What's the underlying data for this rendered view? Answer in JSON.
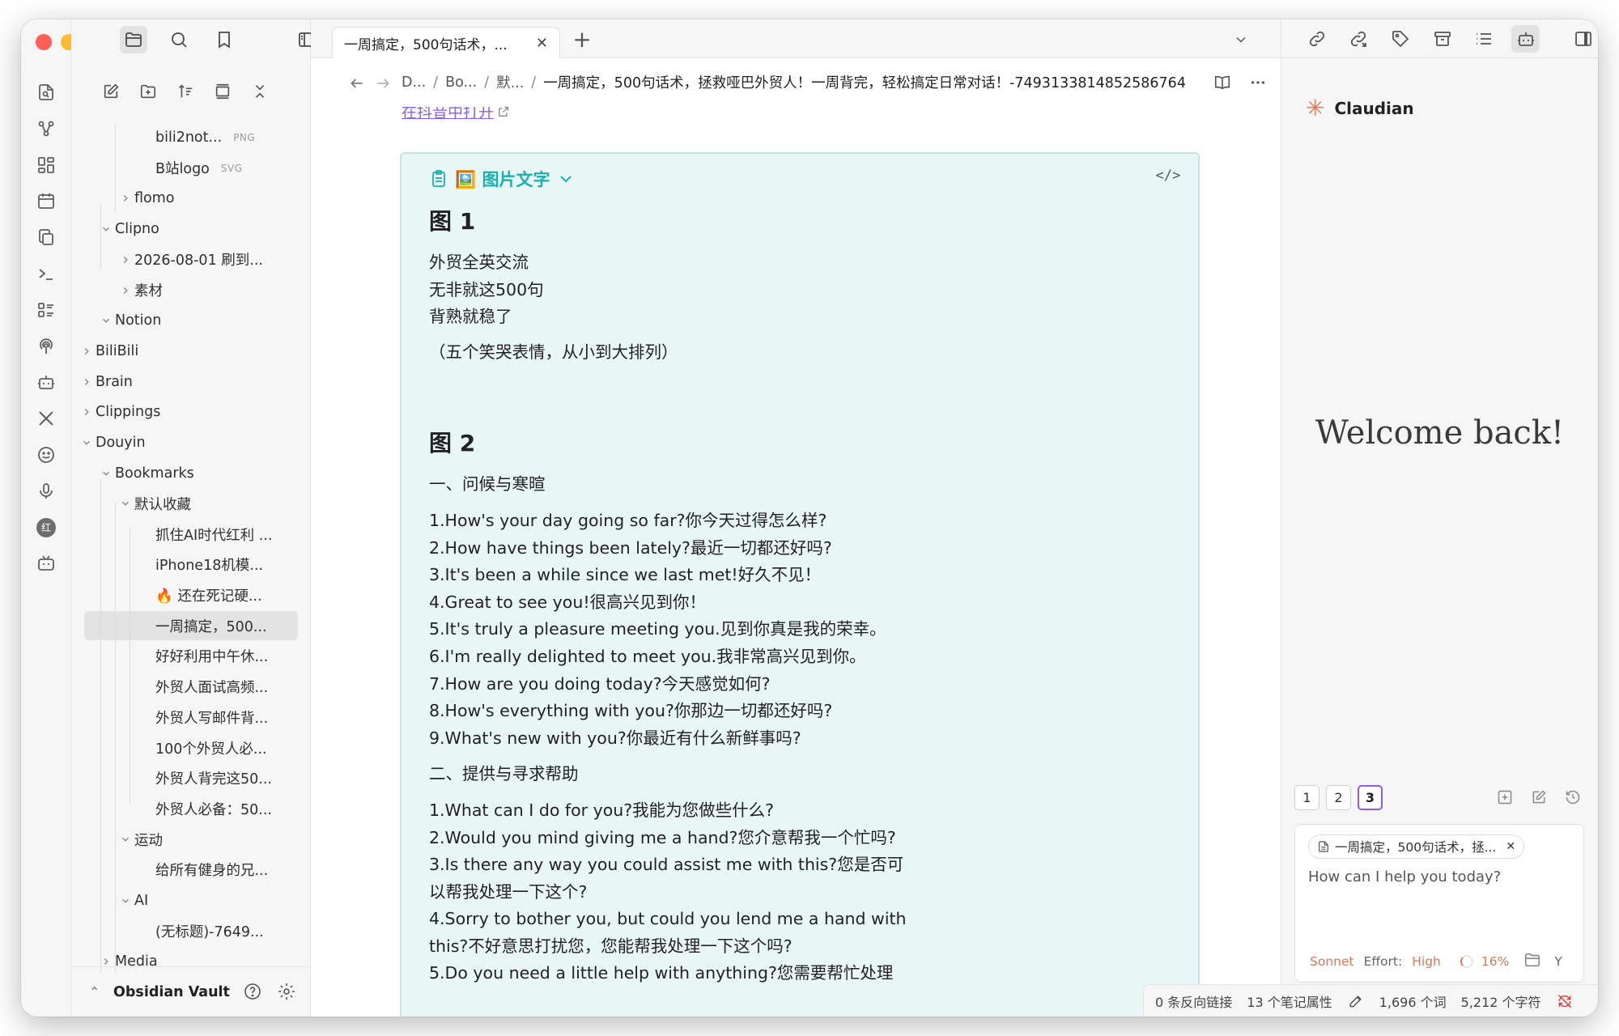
{
  "window": {
    "traffic_colors": [
      "#fe5f57",
      "#febc2e",
      "#28c840"
    ]
  },
  "ribbon": {
    "icons": [
      "file-search-icon",
      "graph-icon",
      "canvas-icon",
      "calendar-icon",
      "copy-icon",
      "terminal-icon",
      "list-icon",
      "podcast-icon",
      "bot-icon",
      "x-logo-icon",
      "face-icon",
      "microphone-icon",
      "xiaohongshu-icon",
      "bilibili-icon"
    ],
    "xiaohongshu_label": "红"
  },
  "sidebar": {
    "top_icons": [
      "folder-icon",
      "search-icon",
      "bookmark-icon"
    ],
    "toggle_icon": "sidebar-toggle-icon",
    "actions": [
      "new-note-icon",
      "new-folder-icon",
      "sort-icon",
      "collapse-icon",
      "close-all-icon"
    ],
    "tree": [
      {
        "label": "bili2not...",
        "ext": "PNG",
        "level": 4,
        "type": "file"
      },
      {
        "label": "B站logo",
        "ext": "SVG",
        "level": 4,
        "type": "file"
      },
      {
        "label": "flomo",
        "level": 3,
        "type": "folder",
        "open": false
      },
      {
        "label": "Clipno",
        "level": 2,
        "type": "folder",
        "open": true
      },
      {
        "label": "2026-08-01 刷到...",
        "level": 3,
        "type": "folder",
        "open": false
      },
      {
        "label": "素材",
        "level": 3,
        "type": "folder",
        "open": false
      },
      {
        "label": "Notion",
        "level": 2,
        "type": "folder",
        "open": true
      },
      {
        "label": "BiliBili",
        "level": 1,
        "type": "folder",
        "open": false
      },
      {
        "label": "Brain",
        "level": 1,
        "type": "folder",
        "open": false
      },
      {
        "label": "Clippings",
        "level": 1,
        "type": "folder",
        "open": false
      },
      {
        "label": "Douyin",
        "level": 1,
        "type": "folder",
        "open": true
      },
      {
        "label": "Bookmarks",
        "level": 2,
        "type": "folder",
        "open": true
      },
      {
        "label": "默认收藏",
        "level": 3,
        "type": "folder",
        "open": true
      },
      {
        "label": "抓住AI时代红利 ...",
        "level": 4,
        "type": "file"
      },
      {
        "label": "iPhone18机模...",
        "level": 4,
        "type": "file"
      },
      {
        "label": "🔥 还在死记硬...",
        "level": 4,
        "type": "file"
      },
      {
        "label": "一周搞定，500...",
        "level": 4,
        "type": "file",
        "selected": true
      },
      {
        "label": "好好利用中午休...",
        "level": 4,
        "type": "file"
      },
      {
        "label": "外贸人面试高频...",
        "level": 4,
        "type": "file"
      },
      {
        "label": "外贸人写邮件背...",
        "level": 4,
        "type": "file"
      },
      {
        "label": "100个外贸人必...",
        "level": 4,
        "type": "file"
      },
      {
        "label": "外贸人背完这50...",
        "level": 4,
        "type": "file"
      },
      {
        "label": "外贸人必备：50...",
        "level": 4,
        "type": "file"
      },
      {
        "label": "运动",
        "level": 3,
        "type": "folder",
        "open": true
      },
      {
        "label": "给所有健身的兄...",
        "level": 4,
        "type": "file"
      },
      {
        "label": "AI",
        "level": 3,
        "type": "folder",
        "open": true
      },
      {
        "label": "(无标题)-7649...",
        "level": 4,
        "type": "file"
      },
      {
        "label": "Media",
        "level": 2,
        "type": "folder",
        "open": false
      }
    ],
    "vault_name": "Obsidian Vault"
  },
  "editor": {
    "tab_title": "一周搞定，500句话术，...",
    "breadcrumbs": [
      "D...",
      "Bo...",
      "默...",
      "一周搞定，500句话术，拯救哑巴外贸人！一周背完，轻松搞定日常对话！-7493133814852586764"
    ],
    "open_link": "在抖音中打开",
    "callout_title": "🖼️ 图片文字",
    "fig1_heading": "图 1",
    "fig1_lines": [
      "外贸全英交流",
      "无非就这500句",
      "背熟就稳了"
    ],
    "fig1_note": "（五个笑哭表情，从小到大排列）",
    "fig2_heading": "图 2",
    "section1_title": "一、问候与寒暄",
    "section1_lines": [
      "1.How's your day going so far?你今天过得怎么样?",
      "2.How have things been lately?最近一切都还好吗?",
      "3.It's been a while since we last met!好久不见！",
      "4.Great to see you!很高兴见到你！",
      "5.It's truly a pleasure meeting you.见到你真是我的荣幸。",
      "6.I'm really delighted to meet you.我非常高兴见到你。",
      "7.How are you doing today?今天感觉如何?",
      "8.How's everything with you?你那边一切都还好吗?",
      "9.What's new with you?你最近有什么新鲜事吗?"
    ],
    "section2_title": "二、提供与寻求帮助",
    "section2_lines": [
      "1.What can I do for you?我能为您做些什么?",
      "2.Would you mind giving me a hand?您介意帮我一个忙吗?",
      "3.Is there any way you could assist me with this?您是否可",
      "以帮我处理一下这个?",
      "4.Sorry to bother you, but could you lend me a hand with",
      "this?不好意思打扰您，您能帮我处理一下这个吗?",
      "5.Do you need a little help with anything?您需要帮忙处理"
    ]
  },
  "right_panel": {
    "top_icons": [
      "link-icon",
      "outgoing-link-icon",
      "tag-icon",
      "archive-icon",
      "outline-icon",
      "bot-icon",
      "sidebar-right-icon"
    ],
    "app_name": "Claudian",
    "welcome": "Welcome back!",
    "conv_tabs": [
      "1",
      "2",
      "3"
    ],
    "active_conv": "3",
    "context_chip": "一周搞定，500句话术，拯...",
    "prompt_placeholder": "How can I help you today?",
    "model": "Sonnet",
    "effort_label": "Effort:",
    "effort_value": "High",
    "context_pct": "16%",
    "trailing": "Y"
  },
  "status": {
    "backlinks": "0 条反向链接",
    "properties": "13 个笔记属性",
    "words": "1,696 个词",
    "chars": "5,212 个字符"
  }
}
